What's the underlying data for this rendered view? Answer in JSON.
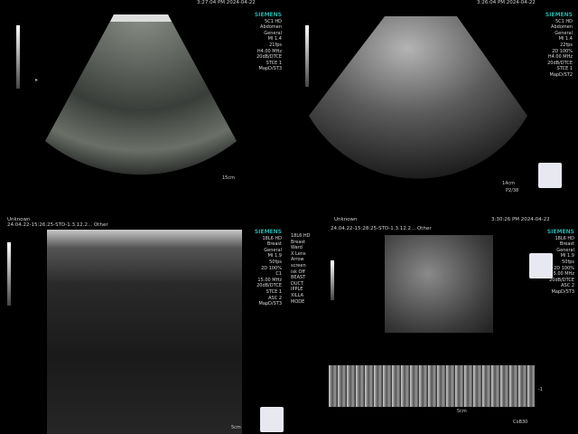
{
  "q1": {
    "timestamp": "3:27:04 PM 2024-04-22",
    "panel": [
      "SIEMENS",
      "5C1 HD",
      "Abdomen",
      "General",
      "MI 1.4",
      "21fps",
      "H4.00 MHz",
      "20dB/DTCE",
      "STCE 1",
      "MapD/ST3"
    ],
    "depth": "15cm"
  },
  "q2": {
    "timestamp": "3:26:04 PM 2024-04-22",
    "panel": [
      "SIEMENS",
      "5C1 HD",
      "Abdomen",
      "General",
      "MI 1.4",
      "22fps",
      "2D 100%",
      "H4.00 MHz",
      "20dB/DTCE",
      "STCE 1",
      "MapD/ST2"
    ],
    "depth": "14cm",
    "bottom_label": "P2/38"
  },
  "q3": {
    "top_left": "Unknown",
    "id_line": "24.04.22-15:26:25-STD-1.3.12.2...  Other",
    "panel": [
      "SIEMENS",
      "18L6 HD",
      "Breast",
      "General",
      "MI 1.9",
      "50fps",
      "2D 100%",
      "C1",
      "15.00 MHz",
      "20dB/DTCE",
      "STCE 1",
      "ASC 2",
      "MapD/ST3"
    ],
    "depth": "5cm"
  },
  "q4": {
    "top_left": "Unknown",
    "timestamp": "3:30:26 PM 2024-04-22",
    "id_line": "24.04.22-15:28:25-STD-1.3.12.2...  Other",
    "left_menu": [
      "18L6 HD",
      "Breast",
      "Ward",
      "X Lens",
      "Arrow",
      "screen",
      "isk Off",
      "BEAST",
      "DUCT",
      "IPPLE",
      "XILLA",
      "MODE"
    ],
    "panel": [
      "SIEMENS",
      "18L6 HD",
      "Breast",
      "General",
      "MI 1.9",
      "50fps",
      "2D 100%",
      "15.00 MHz",
      "20dB/DTCE",
      "ASC 2",
      "MapD/ST3"
    ],
    "depth": "5cm",
    "mmode_time": "-1",
    "bottom_label": "CoB30"
  }
}
